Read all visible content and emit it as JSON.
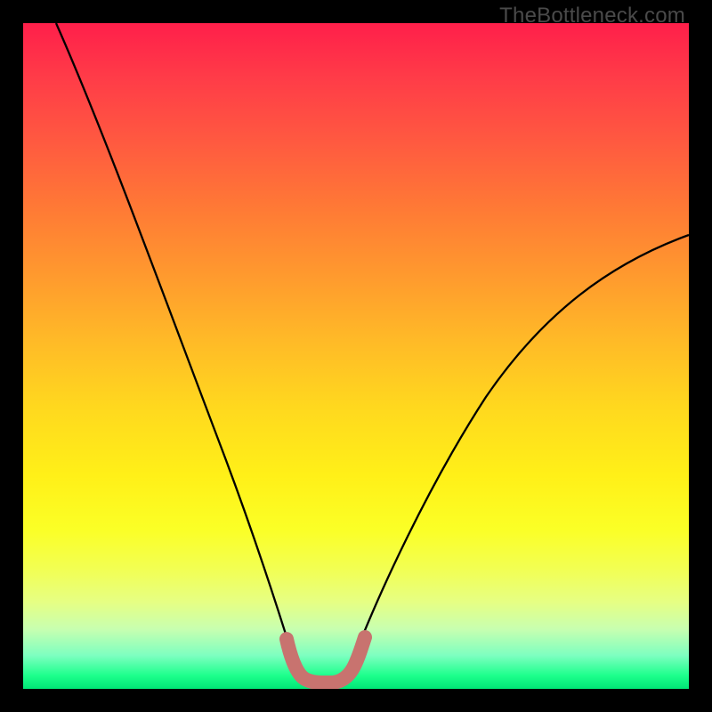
{
  "watermark": "TheBottleneck.com",
  "chart_data": {
    "type": "line",
    "title": "",
    "xlabel": "",
    "ylabel": "",
    "xlim": [
      0,
      100
    ],
    "ylim": [
      0,
      100
    ],
    "series": [
      {
        "name": "curve",
        "color": "#000000",
        "x": [
          5,
          10,
          15,
          20,
          25,
          30,
          35,
          40,
          41,
          42,
          43,
          44,
          45,
          46,
          47,
          48,
          49,
          50,
          55,
          60,
          65,
          70,
          75,
          80,
          85,
          90,
          95,
          100
        ],
        "y": [
          100,
          88,
          77,
          66,
          55,
          44,
          30,
          12,
          8,
          5,
          3,
          2,
          1.5,
          1.5,
          2,
          3,
          5,
          8,
          20,
          32,
          42,
          50,
          56,
          61,
          64,
          66,
          67.5,
          68
        ]
      }
    ],
    "annotations": [
      {
        "name": "trough-highlight",
        "color": "#c8736f",
        "x": [
          40,
          41,
          42,
          43,
          44,
          45,
          46,
          47,
          48,
          49,
          50
        ],
        "y": [
          12,
          8,
          5,
          3,
          2,
          1.5,
          2,
          3,
          5,
          8,
          12
        ]
      }
    ]
  }
}
